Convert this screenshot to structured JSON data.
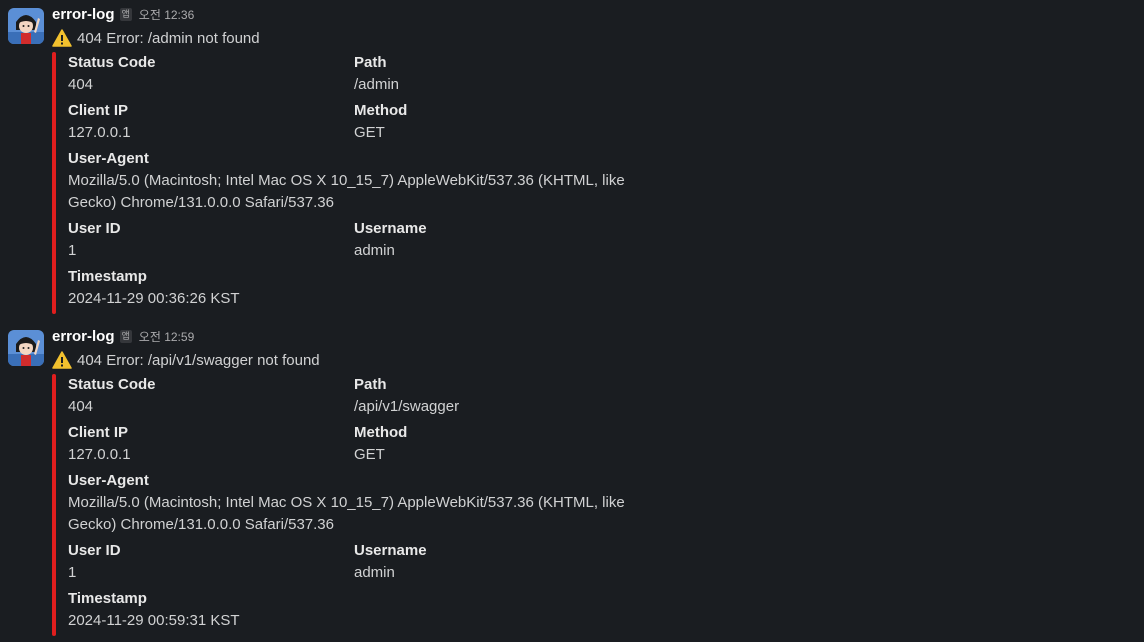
{
  "messages": [
    {
      "sender": "error-log",
      "app_badge": "앱",
      "time": "오전 12:36",
      "title": "404 Error: /admin not found",
      "title_icon": "warning-icon",
      "accent_color": "#e01e1e",
      "fields": {
        "status_code": {
          "label": "Status Code",
          "value": "404"
        },
        "path": {
          "label": "Path",
          "value": "/admin"
        },
        "client_ip": {
          "label": "Client IP",
          "value": "127.0.0.1"
        },
        "method": {
          "label": "Method",
          "value": "GET"
        },
        "user_agent": {
          "label": "User-Agent",
          "value_line1": "Mozilla/5.0 (Macintosh; Intel Mac OS X 10_15_7) AppleWebKit/537.36 (KHTML, like",
          "value_line2": "Gecko) Chrome/131.0.0.0 Safari/537.36"
        },
        "user_id": {
          "label": "User ID",
          "value": "1"
        },
        "username": {
          "label": "Username",
          "value": "admin"
        },
        "timestamp": {
          "label": "Timestamp",
          "value": "2024-11-29 00:36:26 KST"
        }
      }
    },
    {
      "sender": "error-log",
      "app_badge": "앱",
      "time": "오전 12:59",
      "title": "404 Error: /api/v1/swagger not found",
      "title_icon": "warning-icon",
      "accent_color": "#e01e1e",
      "fields": {
        "status_code": {
          "label": "Status Code",
          "value": "404"
        },
        "path": {
          "label": "Path",
          "value": "/api/v1/swagger"
        },
        "client_ip": {
          "label": "Client IP",
          "value": "127.0.0.1"
        },
        "method": {
          "label": "Method",
          "value": "GET"
        },
        "user_agent": {
          "label": "User-Agent",
          "value_line1": "Mozilla/5.0 (Macintosh; Intel Mac OS X 10_15_7) AppleWebKit/537.36 (KHTML, like",
          "value_line2": "Gecko) Chrome/131.0.0.0 Safari/537.36"
        },
        "user_id": {
          "label": "User ID",
          "value": "1"
        },
        "username": {
          "label": "Username",
          "value": "admin"
        },
        "timestamp": {
          "label": "Timestamp",
          "value": "2024-11-29 00:59:31 KST"
        }
      }
    }
  ]
}
